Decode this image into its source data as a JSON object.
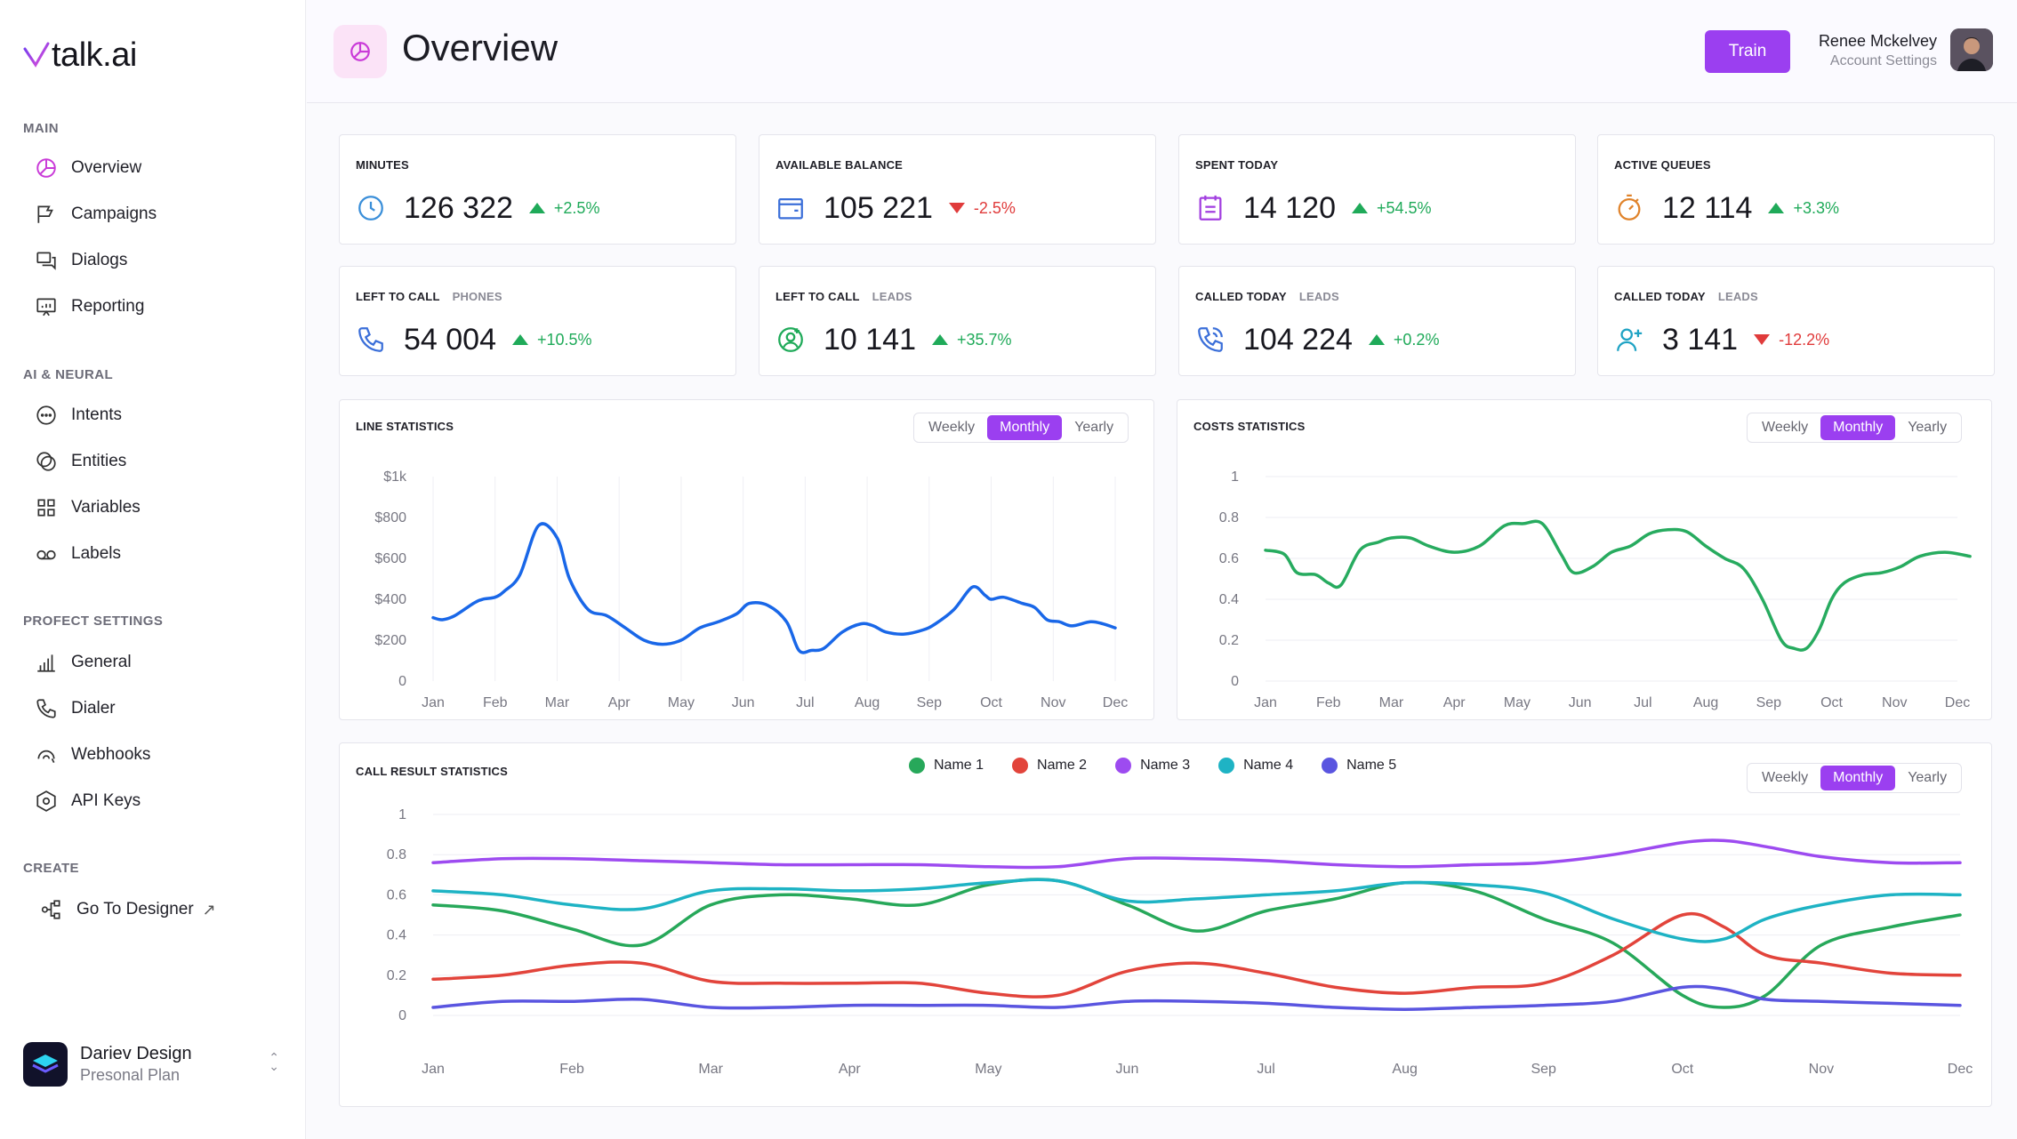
{
  "sidebar": {
    "logo_text": "talk.ai",
    "sections": [
      {
        "title": "MAIN",
        "items": [
          {
            "label": "Overview",
            "icon": "chart-pie-icon"
          },
          {
            "label": "Campaigns",
            "icon": "flag-icon"
          },
          {
            "label": "Dialogs",
            "icon": "chat-icon"
          },
          {
            "label": "Reporting",
            "icon": "presentation-icon"
          }
        ]
      },
      {
        "title": "AI & NEURAL",
        "items": [
          {
            "label": "Intents",
            "icon": "message-dots-icon"
          },
          {
            "label": "Entities",
            "icon": "shapes-icon"
          },
          {
            "label": "Variables",
            "icon": "grid-icon"
          },
          {
            "label": "Labels",
            "icon": "tag-icon"
          }
        ]
      },
      {
        "title": "PROFECT SETTINGS",
        "items": [
          {
            "label": "General",
            "icon": "bar-chart-icon"
          },
          {
            "label": "Dialer",
            "icon": "phone-icon"
          },
          {
            "label": "Webhooks",
            "icon": "webhook-icon"
          },
          {
            "label": "API Keys",
            "icon": "hexagon-icon"
          }
        ]
      },
      {
        "title": "CREATE",
        "items": [
          {
            "label": "Go To Designer",
            "icon": "designer-icon",
            "external": "↗"
          }
        ]
      }
    ],
    "workspace": {
      "name": "Dariev Design",
      "plan": "Presonal Plan"
    }
  },
  "header": {
    "title": "Overview",
    "train_label": "Train",
    "user_name": "Renee Mckelvey",
    "user_sub": "Account Settings"
  },
  "stats": [
    {
      "title": "MINUTES",
      "sub": "",
      "value": "126 322",
      "trend": "+2.5%",
      "dir": "up",
      "icon": "clock-icon",
      "color": "#3b8fd9"
    },
    {
      "title": "AVAILABLE BALANCE",
      "sub": "",
      "value": "105 221",
      "trend": "-2.5%",
      "dir": "down",
      "icon": "wallet-icon",
      "color": "#3b6fd9"
    },
    {
      "title": "SPENT TODAY",
      "sub": "",
      "value": "14 120",
      "trend": "+54.5%",
      "dir": "up",
      "icon": "calendar-icon",
      "color": "#a23fe0"
    },
    {
      "title": "ACTIVE QUEUES",
      "sub": "",
      "value": "12 114",
      "trend": "+3.3%",
      "dir": "up",
      "icon": "stopwatch-icon",
      "color": "#e0832b"
    },
    {
      "title": "LEFT TO CALL",
      "sub": "PHONES",
      "value": "54 004",
      "trend": "+10.5%",
      "dir": "up",
      "icon": "phone-icon",
      "color": "#3b6fd9"
    },
    {
      "title": "LEFT TO CALL",
      "sub": "LEADS",
      "value": "10 141",
      "trend": "+35.7%",
      "dir": "up",
      "icon": "user-add-icon",
      "color": "#1faa59"
    },
    {
      "title": "CALLED TODAY",
      "sub": "LEADS",
      "value": "104 224",
      "trend": "+0.2%",
      "dir": "up",
      "icon": "phone-call-icon",
      "color": "#3b6fd9"
    },
    {
      "title": "CALLED TODAY",
      "sub": "LEADS",
      "value": "3 141",
      "trend": "-12.2%",
      "dir": "down",
      "icon": "user-plus-icon",
      "color": "#1fa3c4"
    }
  ],
  "segment_labels": [
    "Weekly",
    "Monthly",
    "Yearly"
  ],
  "segment_active": "Monthly",
  "colors": {
    "accent": "#9b3ff0",
    "up": "#1faa59",
    "down": "#e03b3b"
  },
  "chart_data": [
    {
      "type": "line",
      "title": "LINE STATISTICS",
      "categories": [
        "Jan",
        "Feb",
        "Mar",
        "Apr",
        "May",
        "Jun",
        "Jul",
        "Aug",
        "Sep",
        "Oct",
        "Nov",
        "Dec"
      ],
      "yticks": [
        "0",
        "$200",
        "$400",
        "$600",
        "$800",
        "$1k"
      ],
      "ylim": [
        0,
        1000
      ],
      "grid": "vertical",
      "series": [
        {
          "color": "#1967e8",
          "x": [
            0,
            0.15,
            0.35,
            0.65,
            0.8,
            1.0,
            1.15,
            1.4,
            1.7,
            2.0,
            2.2,
            2.5,
            2.8,
            3.1,
            3.4,
            3.7,
            4.0,
            4.3,
            4.6,
            4.9,
            5.1,
            5.4,
            5.7,
            5.9,
            6.1,
            6.3,
            6.6,
            6.9,
            7.1,
            7.3,
            7.6,
            7.9,
            8.1,
            8.4,
            8.7,
            8.9,
            9.0,
            9.2,
            9.5,
            9.7,
            9.9,
            10.1,
            10.3,
            10.6,
            10.8,
            11.0
          ],
          "values": [
            310,
            300,
            320,
            380,
            400,
            410,
            440,
            520,
            760,
            700,
            500,
            350,
            320,
            260,
            200,
            180,
            200,
            260,
            290,
            330,
            380,
            370,
            290,
            150,
            150,
            160,
            240,
            280,
            270,
            240,
            230,
            250,
            280,
            350,
            460,
            420,
            400,
            410,
            380,
            360,
            300,
            290,
            270,
            290,
            280,
            260
          ]
        }
      ]
    },
    {
      "type": "line",
      "title": "COSTS STATISTICS",
      "categories": [
        "Jan",
        "Feb",
        "Mar",
        "Apr",
        "May",
        "Jun",
        "Jul",
        "Aug",
        "Sep",
        "Oct",
        "Nov",
        "Dec"
      ],
      "yticks": [
        "0",
        "0.2",
        "0.4",
        "0.6",
        "0.8",
        "1"
      ],
      "ylim": [
        0,
        1
      ],
      "grid": "horizontal",
      "series": [
        {
          "color": "#27ab5f",
          "x": [
            0,
            0.3,
            0.5,
            0.8,
            1.0,
            1.2,
            1.5,
            1.8,
            2.0,
            2.3,
            2.6,
            3.0,
            3.4,
            3.8,
            4.1,
            4.4,
            4.7,
            4.9,
            5.2,
            5.5,
            5.8,
            6.1,
            6.4,
            6.7,
            7.0,
            7.3,
            7.6,
            7.9,
            8.2,
            8.4,
            8.6,
            8.8,
            9.0,
            9.2,
            9.5,
            9.8,
            10.1,
            10.4,
            10.8,
            11.2
          ],
          "values": [
            0.64,
            0.62,
            0.53,
            0.52,
            0.48,
            0.47,
            0.64,
            0.68,
            0.7,
            0.7,
            0.66,
            0.63,
            0.66,
            0.76,
            0.77,
            0.77,
            0.62,
            0.53,
            0.56,
            0.63,
            0.66,
            0.72,
            0.74,
            0.73,
            0.66,
            0.6,
            0.55,
            0.4,
            0.2,
            0.16,
            0.16,
            0.25,
            0.4,
            0.48,
            0.52,
            0.53,
            0.56,
            0.61,
            0.63,
            0.61
          ]
        }
      ]
    },
    {
      "type": "line",
      "title": "CALL RESULT STATISTICS",
      "categories": [
        "Jan",
        "Feb",
        "Mar",
        "Apr",
        "May",
        "Jun",
        "Jul",
        "Aug",
        "Sep",
        "Oct",
        "Nov",
        "Dec"
      ],
      "yticks": [
        "0",
        "0.2",
        "0.4",
        "0.6",
        "0.8",
        "1"
      ],
      "ylim": [
        0,
        1
      ],
      "grid": "horizontal",
      "series": [
        {
          "name": "Name 1",
          "color": "#27a85a",
          "x": [
            0,
            0.5,
            1.0,
            1.5,
            2.0,
            2.5,
            3.0,
            3.5,
            4.0,
            4.5,
            5.0,
            5.5,
            6.0,
            6.5,
            7.0,
            7.5,
            8.0,
            8.5,
            9.0,
            9.3,
            9.6,
            10.0,
            10.5,
            11.0
          ],
          "values": [
            0.55,
            0.52,
            0.43,
            0.35,
            0.55,
            0.6,
            0.58,
            0.55,
            0.65,
            0.67,
            0.55,
            0.42,
            0.52,
            0.58,
            0.66,
            0.62,
            0.48,
            0.36,
            0.1,
            0.04,
            0.1,
            0.35,
            0.44,
            0.5
          ]
        },
        {
          "name": "Name 2",
          "color": "#e2443b",
          "x": [
            0,
            0.5,
            1.0,
            1.5,
            2.0,
            2.5,
            3.0,
            3.5,
            4.0,
            4.5,
            5.0,
            5.5,
            6.0,
            6.5,
            7.0,
            7.5,
            8.0,
            8.5,
            9.0,
            9.3,
            9.6,
            10.0,
            10.5,
            11.0
          ],
          "values": [
            0.18,
            0.2,
            0.25,
            0.26,
            0.17,
            0.16,
            0.16,
            0.16,
            0.11,
            0.1,
            0.22,
            0.26,
            0.21,
            0.14,
            0.11,
            0.14,
            0.16,
            0.3,
            0.5,
            0.44,
            0.3,
            0.26,
            0.21,
            0.2
          ]
        },
        {
          "name": "Name 3",
          "color": "#9d4bf0",
          "x": [
            0,
            0.5,
            1.0,
            1.5,
            2.0,
            2.5,
            3.0,
            3.5,
            4.0,
            4.5,
            5.0,
            5.5,
            6.0,
            6.5,
            7.0,
            7.5,
            8.0,
            8.5,
            9.0,
            9.3,
            9.6,
            10.0,
            10.5,
            11.0
          ],
          "values": [
            0.76,
            0.78,
            0.78,
            0.77,
            0.76,
            0.75,
            0.75,
            0.75,
            0.74,
            0.74,
            0.78,
            0.78,
            0.77,
            0.75,
            0.74,
            0.75,
            0.76,
            0.8,
            0.86,
            0.87,
            0.84,
            0.79,
            0.76,
            0.76
          ]
        },
        {
          "name": "Name 4",
          "color": "#1eb3c4",
          "x": [
            0,
            0.5,
            1.0,
            1.5,
            2.0,
            2.5,
            3.0,
            3.5,
            4.0,
            4.5,
            5.0,
            5.5,
            6.0,
            6.5,
            7.0,
            7.5,
            8.0,
            8.5,
            9.0,
            9.3,
            9.6,
            10.0,
            10.5,
            11.0
          ],
          "values": [
            0.62,
            0.6,
            0.55,
            0.53,
            0.62,
            0.63,
            0.62,
            0.63,
            0.66,
            0.67,
            0.57,
            0.58,
            0.6,
            0.62,
            0.66,
            0.65,
            0.61,
            0.48,
            0.38,
            0.38,
            0.48,
            0.55,
            0.6,
            0.6
          ]
        },
        {
          "name": "Name 5",
          "color": "#5a55e0",
          "x": [
            0,
            0.5,
            1.0,
            1.5,
            2.0,
            2.5,
            3.0,
            3.5,
            4.0,
            4.5,
            5.0,
            5.5,
            6.0,
            6.5,
            7.0,
            7.5,
            8.0,
            8.5,
            9.0,
            9.3,
            9.6,
            10.0,
            10.5,
            11.0
          ],
          "values": [
            0.04,
            0.07,
            0.07,
            0.08,
            0.04,
            0.04,
            0.05,
            0.05,
            0.05,
            0.04,
            0.07,
            0.07,
            0.06,
            0.04,
            0.03,
            0.04,
            0.05,
            0.07,
            0.14,
            0.13,
            0.08,
            0.07,
            0.06,
            0.05
          ]
        }
      ]
    }
  ]
}
